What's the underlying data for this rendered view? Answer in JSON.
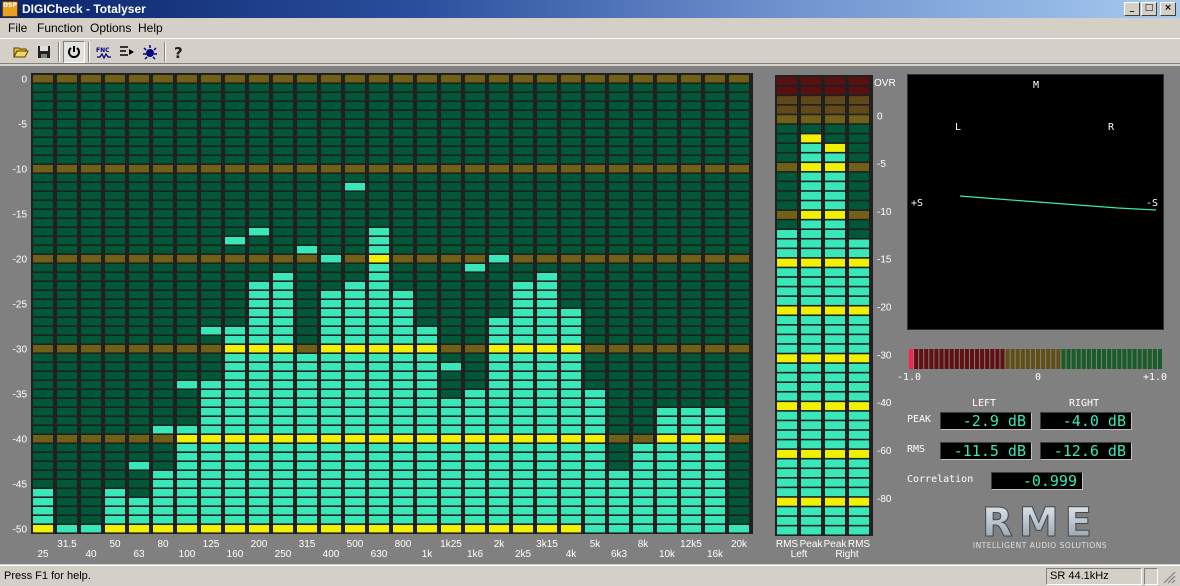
{
  "window": {
    "title": "DIGICheck - Totalyser",
    "icon_text": "DSP",
    "minimize_glyph": "_",
    "maximize_glyph": "□",
    "close_glyph": "×"
  },
  "menu": [
    "File",
    "Function",
    "Options",
    "Help"
  ],
  "toolbar": [
    {
      "name": "open-icon"
    },
    {
      "name": "save-icon"
    },
    {
      "name": "power-icon",
      "pressed": true
    },
    {
      "name": "fnc-icon",
      "label": "FNC"
    },
    {
      "name": "filter-icon"
    },
    {
      "name": "settings-icon"
    },
    {
      "name": "help-icon"
    }
  ],
  "colors": {
    "lit": "#38e8b8",
    "unlit": "#005838",
    "peak_hold": "#f0f000",
    "gridline": "#706018",
    "ovr_lit": "#d01010",
    "ovr_unlit": "#581010",
    "background": "#808080"
  },
  "spectrum": {
    "y_axis_labels": [
      "0",
      "-5",
      "-10",
      "-15",
      "-20",
      "-25",
      "-30",
      "-35",
      "-40",
      "-45",
      "-50"
    ],
    "bands_top_row": [
      "31.5",
      "50",
      "80",
      "125",
      "200",
      "315",
      "500",
      "800",
      "1k25",
      "2k",
      "3k15",
      "5k",
      "8k",
      "12k5",
      "20k"
    ],
    "bands_bottom_row": [
      "25",
      "40",
      "63",
      "100",
      "160",
      "250",
      "400",
      "630",
      "1k",
      "1k6",
      "2k5",
      "4k",
      "6k3",
      "10k",
      "16k"
    ],
    "bands": [
      "25",
      "31.5",
      "40",
      "50",
      "63",
      "80",
      "100",
      "125",
      "160",
      "200",
      "250",
      "315",
      "400",
      "500",
      "630",
      "800",
      "1k",
      "1k25",
      "1k6",
      "2k",
      "2k5",
      "3k15",
      "4k",
      "5k",
      "6k3",
      "8k",
      "10k",
      "12k5",
      "16k",
      "20k"
    ],
    "level_db": [
      -46.5,
      -50,
      -50,
      -46.5,
      -47,
      -44,
      -38.5,
      -33.5,
      -28,
      -22.5,
      -21.5,
      -31,
      -23.5,
      -23,
      -17,
      -24,
      -28,
      -36,
      -34.5,
      -27,
      -23,
      -22,
      -26,
      -35,
      -44,
      -41,
      -37,
      -36.5,
      -37,
      -49.5
    ],
    "peak_hold_db": [
      -46,
      -50,
      -50,
      -46,
      -42.5,
      -38.5,
      -33.5,
      -27.5,
      -17.5,
      -16.5,
      -31.5,
      -18.5,
      -19.5,
      -12,
      -21.5,
      -27.5,
      -33.5,
      -31.5,
      -20.5,
      -19.5,
      -23.5,
      -32.5,
      -49,
      -50,
      -50,
      -50,
      -50,
      -50,
      -49.5,
      -50
    ]
  },
  "level_meter": {
    "ovr_label": "OVR",
    "scale_labels": [
      "0",
      "-5",
      "-10",
      "-15",
      "-20",
      "-30",
      "-40",
      "-60",
      "-80"
    ],
    "column_labels": [
      "RMS",
      "Peak",
      "Peak",
      "RMS"
    ],
    "channel_labels": [
      "Left",
      "Right"
    ],
    "rms_left_db": -11.5,
    "peak_left_db": -2.9,
    "peak_right_db": -4.0,
    "rms_right_db": -12.6,
    "peak_hold_left_db": -2.0,
    "peak_hold_right_db": -3.0
  },
  "goniometer": {
    "labels": {
      "m": "M",
      "l": "L",
      "r": "R",
      "plus_s": "+S",
      "minus_s": "-S"
    }
  },
  "correlation_meter": {
    "value": -0.999,
    "scale_labels": [
      "-1.0",
      "0",
      "+1.0"
    ]
  },
  "readouts": {
    "left_label": "LEFT",
    "right_label": "RIGHT",
    "peak_label": "PEAK",
    "rms_label": "RMS",
    "correlation_label": "Correlation",
    "peak_left": "-2.9 dB",
    "peak_right": "-4.0 dB",
    "rms_left": "-11.5 dB",
    "rms_right": "-12.6 dB",
    "correlation": "-0.999"
  },
  "logo": {
    "text": "RME",
    "tagline": "INTELLIGENT AUDIO SOLUTIONS"
  },
  "status": {
    "help_text": "Press F1 for help.",
    "sample_rate": "SR 44.1kHz"
  }
}
